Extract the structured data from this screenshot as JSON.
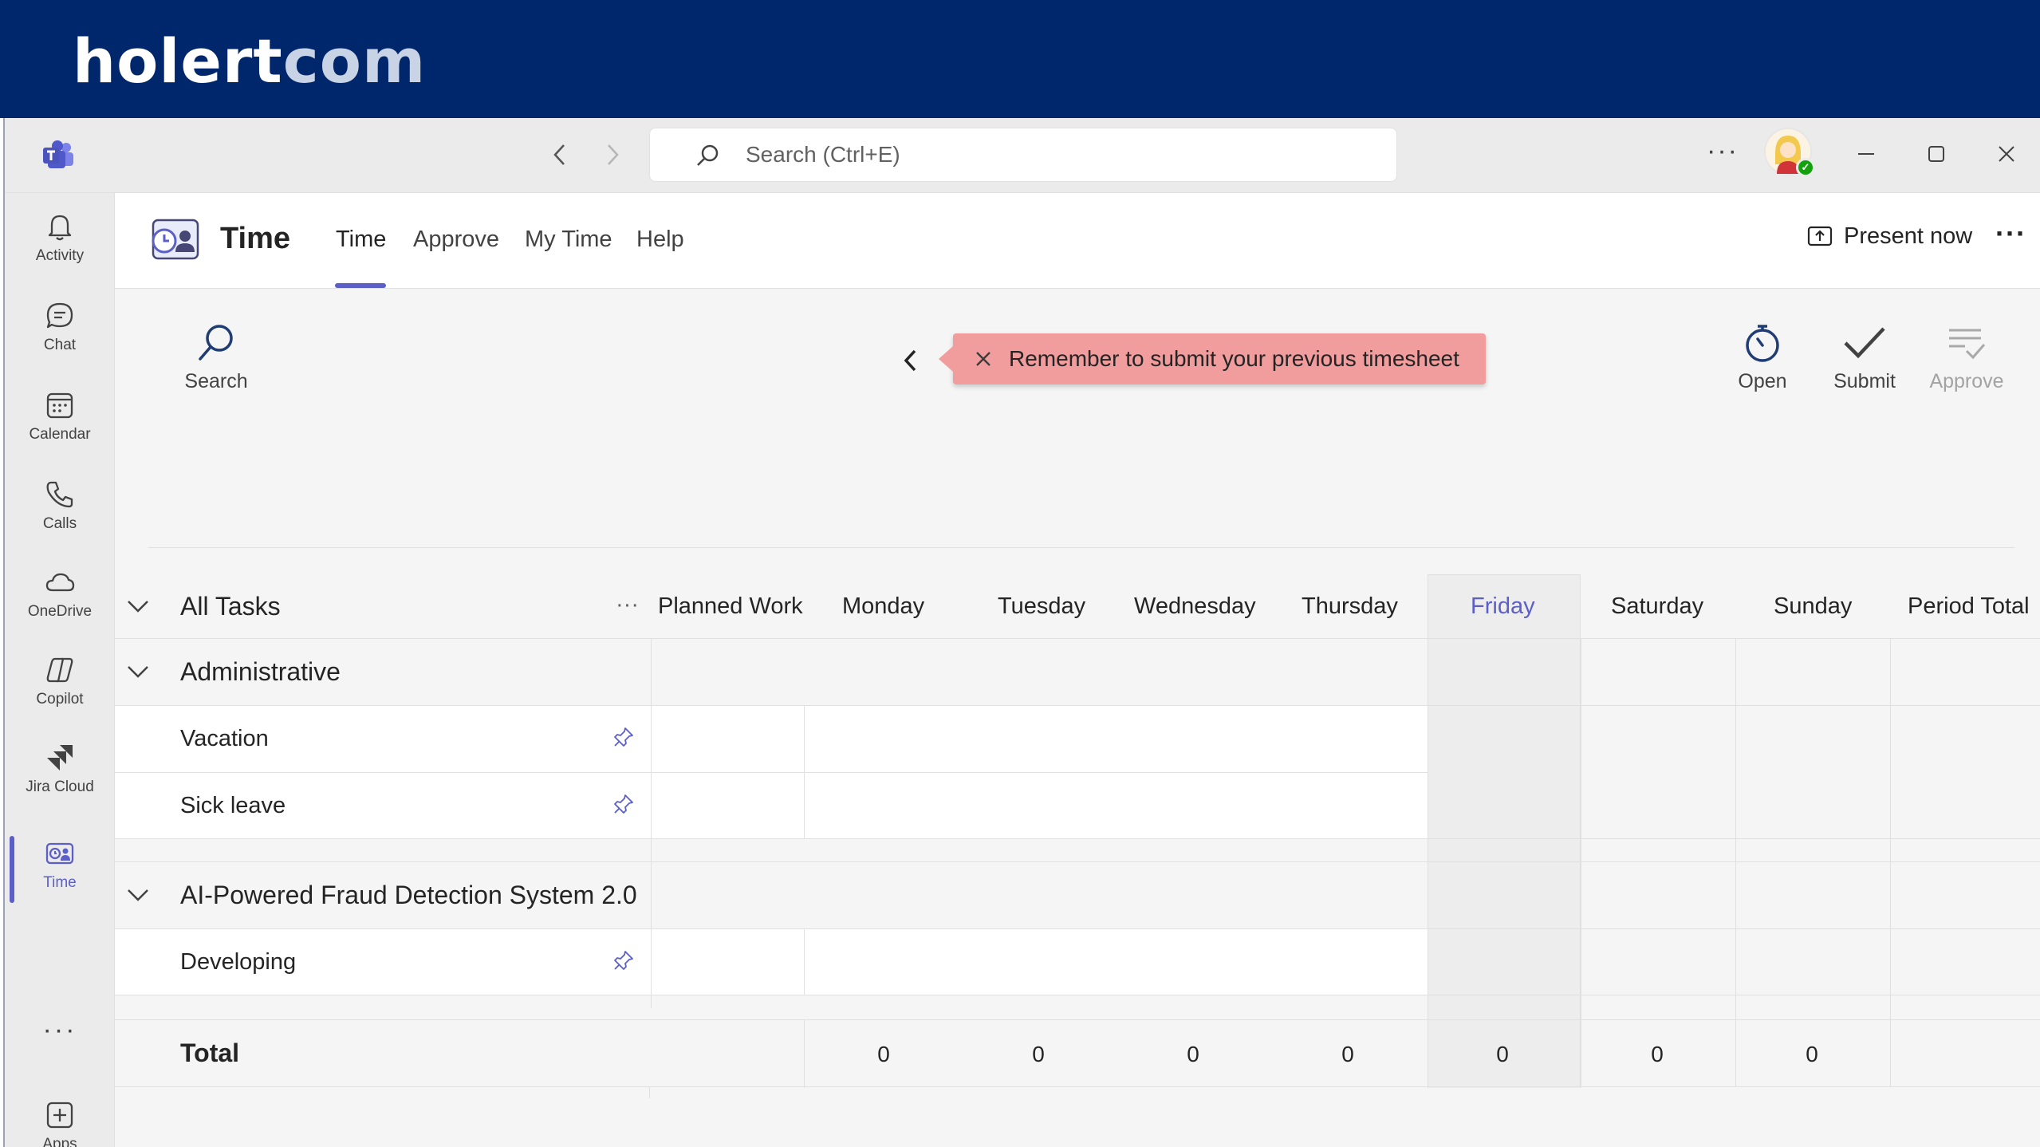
{
  "brand": {
    "part1": "holert",
    "part2": "com"
  },
  "titlebar": {
    "search_placeholder": "Search (Ctrl+E)",
    "more_label": "···"
  },
  "rail": {
    "items": [
      {
        "label": "Activity",
        "icon": "bell-icon"
      },
      {
        "label": "Chat",
        "icon": "chat-icon"
      },
      {
        "label": "Calendar",
        "icon": "calendar-icon"
      },
      {
        "label": "Calls",
        "icon": "phone-icon"
      },
      {
        "label": "OneDrive",
        "icon": "cloud-icon"
      },
      {
        "label": "Copilot",
        "icon": "copilot-icon"
      },
      {
        "label": "Jira Cloud",
        "icon": "jira-icon"
      },
      {
        "label": "Time",
        "icon": "time-app-icon",
        "active": true
      },
      {
        "label": "Apps",
        "icon": "add-app-icon"
      }
    ],
    "more": "···"
  },
  "app": {
    "title": "Time",
    "tabs": [
      {
        "label": "Time",
        "active": true
      },
      {
        "label": "Approve"
      },
      {
        "label": "My Time"
      },
      {
        "label": "Help"
      }
    ],
    "present_now": "Present now",
    "more": "···"
  },
  "toolbar": {
    "search": "Search",
    "open": "Open",
    "submit": "Submit",
    "approve": "Approve",
    "notice": "Remember to submit your previous timesheet"
  },
  "grid": {
    "task_header": "All Tasks",
    "task_header_more": "···",
    "columns": [
      "Planned Work",
      "Monday",
      "Tuesday",
      "Wednesday",
      "Thursday",
      "Friday",
      "Saturday",
      "Sunday",
      "Period Total"
    ],
    "highlight_column": "Friday",
    "groups": [
      {
        "name": "Administrative",
        "tasks": [
          "Vacation",
          "Sick leave"
        ]
      },
      {
        "name": "AI-Powered Fraud Detection System 2.0",
        "tasks": [
          "Developing"
        ]
      }
    ],
    "total_label": "Total",
    "totals": [
      "0",
      "0",
      "0",
      "0",
      "0",
      "0",
      "0"
    ]
  },
  "colors": {
    "brand_bar": "#00266b",
    "accent": "#5b5fc7",
    "notice_bg": "#f19d9d",
    "presence": "#13a10e"
  }
}
